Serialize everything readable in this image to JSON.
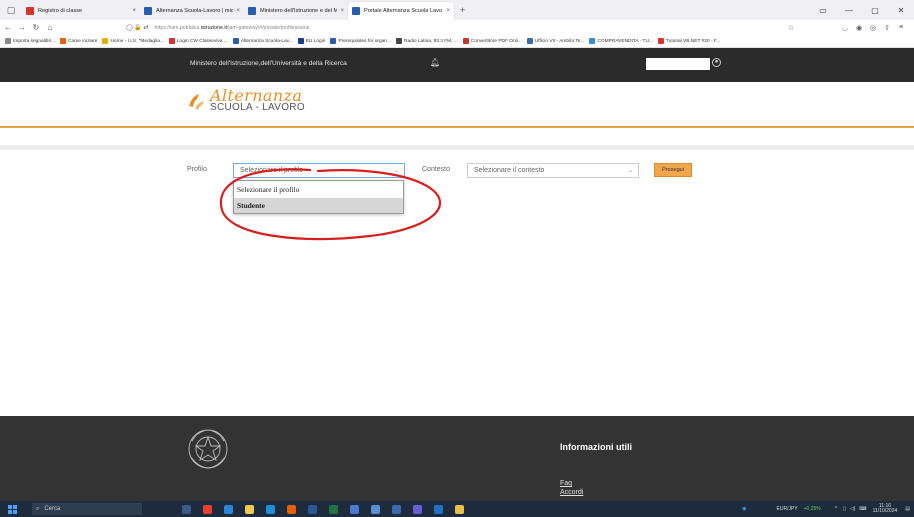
{
  "browser": {
    "tabs": [
      {
        "title": "Registro di classe",
        "color": "#d9342b",
        "active": false
      },
      {
        "title": "Alternanza Scuola-Lavoro | mio",
        "color": "#2a5db0",
        "active": false
      },
      {
        "title": "Ministero dell'Istruzione e del M",
        "color": "#2a5db0",
        "active": false
      },
      {
        "title": "Portale Alternanza Scuola Lavo",
        "color": "#2a5db0",
        "active": true
      }
    ],
    "url_prefix": "https://iam.pubblica.",
    "url_domain": "istruzione.it",
    "url_path": "/iam-gateway/#/private/profilessione",
    "bookmarks": [
      {
        "label": "Importa segnalibri...",
        "color": "#888"
      },
      {
        "label": "Come iniziare",
        "color": "#e66000"
      },
      {
        "label": "Home - I.I.S. \"Medaglia...",
        "color": "#e0b000"
      },
      {
        "label": "Login CW Classeviva ...",
        "color": "#d9342b"
      },
      {
        "label": "Alternanza Scuola-Lav...",
        "color": "#2a5db0"
      },
      {
        "label": "EU Login",
        "color": "#1a3a8a"
      },
      {
        "label": "Prerequisites for organ...",
        "color": "#2a5db0"
      },
      {
        "label": "Radio Latina, 93.3 FM, ...",
        "color": "#444"
      },
      {
        "label": "Convertitore PDF Onli...",
        "color": "#c0392b"
      },
      {
        "label": "Ufficio VII - Ambito Te...",
        "color": "#3a6ab0"
      },
      {
        "label": "COMPRAVENDITA - TU...",
        "color": "#3a8ad0"
      },
      {
        "label": "Tutorial VB.NET #20 - F...",
        "color": "#d9342b"
      }
    ]
  },
  "site": {
    "ministry": "Ministero dell'Istruzione,dell'Università e della Ricerca",
    "logo_line1": "Alternanza",
    "logo_line2": "SCUOLA - LAVORO",
    "accent": "#e7902e"
  },
  "form": {
    "profilo_label": "Profilo",
    "profilo_selected": "Selezionare il profilo",
    "contesto_label": "Contesto",
    "contesto_selected": "Selezionare il contesto",
    "submit_label": "Prosegui",
    "dropdown_options": [
      "Selezionare il profilo",
      "Studente"
    ],
    "hovered_option": "Studente"
  },
  "footer": {
    "info_title": "Informazioni utili",
    "links": [
      "Faq",
      "Accordi"
    ]
  },
  "taskbar": {
    "search_placeholder": "Cerca",
    "currency": "EUR/JPY",
    "currency_change": "+0,25%",
    "time": "11:16",
    "date": "11/10/2024"
  },
  "colors": {
    "annotation_red": "#d6201f",
    "header_dark": "#2b2b2b",
    "footer_dark": "#333333",
    "button_orange": "#f2a74d"
  }
}
